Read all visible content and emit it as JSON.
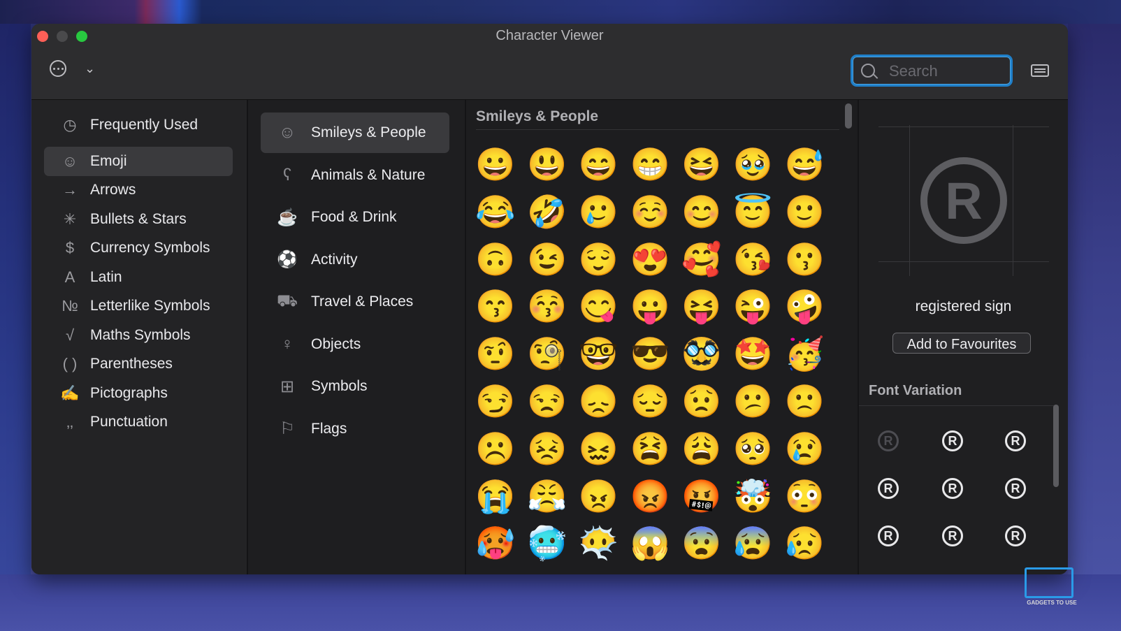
{
  "window": {
    "title": "Character Viewer"
  },
  "toolbar": {
    "search_placeholder": "Search"
  },
  "categories": [
    {
      "label": "Frequently Used",
      "icon": "clock-icon",
      "glyph": "◷"
    },
    {
      "label": "Emoji",
      "icon": "smiley-icon",
      "glyph": "☺",
      "selected": true
    },
    {
      "label": "Arrows",
      "icon": "arrow-icon",
      "glyph": "→"
    },
    {
      "label": "Bullets & Stars",
      "icon": "asterisk-icon",
      "glyph": "✳"
    },
    {
      "label": "Currency Symbols",
      "icon": "dollar-icon",
      "glyph": "$"
    },
    {
      "label": "Latin",
      "icon": "latin-a-icon",
      "glyph": "A"
    },
    {
      "label": "Letterlike Symbols",
      "icon": "numero-icon",
      "glyph": "№"
    },
    {
      "label": "Maths Symbols",
      "icon": "sqrt-icon",
      "glyph": "√"
    },
    {
      "label": "Parentheses",
      "icon": "parentheses-icon",
      "glyph": "( )"
    },
    {
      "label": "Pictographs",
      "icon": "pen-icon",
      "glyph": "✍"
    },
    {
      "label": "Punctuation",
      "icon": "punctuation-icon",
      "glyph": "‚‚"
    }
  ],
  "subcategories": [
    {
      "label": "Smileys & People",
      "icon": "smiley-icon",
      "glyph": "☺",
      "selected": true
    },
    {
      "label": "Animals & Nature",
      "icon": "bear-icon",
      "glyph": "ʕ"
    },
    {
      "label": "Food & Drink",
      "icon": "cup-icon",
      "glyph": "☕"
    },
    {
      "label": "Activity",
      "icon": "ball-icon",
      "glyph": "⚽"
    },
    {
      "label": "Travel & Places",
      "icon": "bus-icon",
      "glyph": "⛟"
    },
    {
      "label": "Objects",
      "icon": "bulb-icon",
      "glyph": "♀"
    },
    {
      "label": "Symbols",
      "icon": "symbols-icon",
      "glyph": "⊞"
    },
    {
      "label": "Flags",
      "icon": "flag-icon",
      "glyph": "⚐"
    }
  ],
  "grid": {
    "title": "Smileys & People",
    "emojis": [
      "😀",
      "😃",
      "😄",
      "😁",
      "😆",
      "🥹",
      "😅",
      "😂",
      "🤣",
      "🥲",
      "☺️",
      "😊",
      "😇",
      "🙂",
      "🙃",
      "😉",
      "😌",
      "😍",
      "🥰",
      "😘",
      "😗",
      "😙",
      "😚",
      "😋",
      "😛",
      "😝",
      "😜",
      "🤪",
      "🤨",
      "🧐",
      "🤓",
      "😎",
      "🥸",
      "🤩",
      "🥳",
      "😏",
      "😒",
      "😞",
      "😔",
      "😟",
      "😕",
      "🙁",
      "☹️",
      "😣",
      "😖",
      "😫",
      "😩",
      "🥺",
      "😢",
      "😭",
      "😤",
      "😠",
      "😡",
      "🤬",
      "🤯",
      "😳",
      "🥵",
      "🥶",
      "😶‍🌫️",
      "😱",
      "😨",
      "😰",
      "😥"
    ]
  },
  "detail": {
    "glyph": "R",
    "name": "registered sign",
    "add_button": "Add to Favourites",
    "font_variation_title": "Font Variation",
    "variations": [
      "R",
      "R",
      "R",
      "R",
      "R",
      "R",
      "R",
      "R",
      "R"
    ]
  },
  "watermark": {
    "text": "GADGETS TO USE"
  }
}
